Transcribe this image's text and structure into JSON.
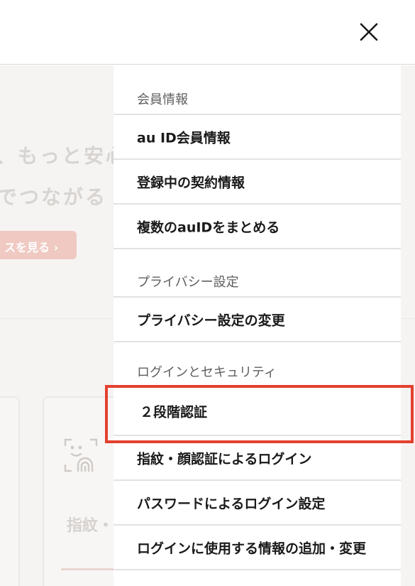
{
  "background": {
    "hero_line1": "、もっと安心",
    "hero_line2": "でつながる",
    "cta_label": "スを見る ›",
    "card_label": "指紋・"
  },
  "menu": {
    "sections": [
      {
        "heading": "会員情報",
        "items": [
          "au ID会員情報",
          "登録中の契約情報",
          "複数のauIDをまとめる"
        ]
      },
      {
        "heading": "プライバシー設定",
        "items": [
          "プライバシー設定の変更"
        ]
      },
      {
        "heading": "ログインとセキュリティ",
        "items": [
          "２段階認証",
          "指紋・顔認証によるログイン",
          "パスワードによるログイン設定",
          "ログインに使用する情報の追加・変更"
        ]
      }
    ]
  },
  "highlighted_item": "２段階認証",
  "colors": {
    "highlight": "#e4402f",
    "divider": "#e2e2e2",
    "heading_text": "#5e5e5e",
    "item_text": "#1a1a1a"
  },
  "icons": {
    "close": "close-icon",
    "card": "face-fingerprint-icon"
  }
}
